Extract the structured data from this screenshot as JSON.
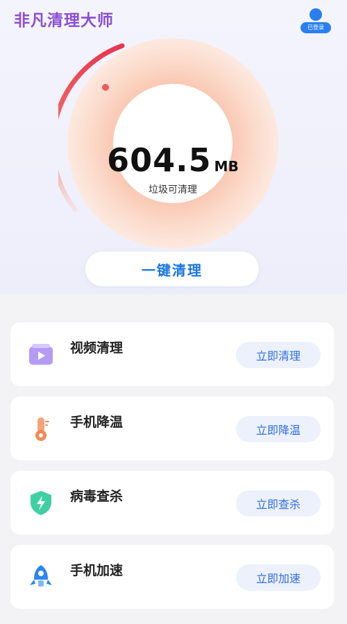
{
  "header": {
    "app_title": "非凡清理大师",
    "user_badge_label": "已登录"
  },
  "gauge": {
    "value": "604.5",
    "unit": "MB",
    "caption": "垃圾可清理",
    "accent_colors": [
      "#f04a5f",
      "#f7b49a",
      "#fde7dc"
    ]
  },
  "clean_button": {
    "label": "一键清理"
  },
  "features": [
    {
      "title": "视频清理",
      "action": "立即清理",
      "icon": "video-icon",
      "color": "#a98af0"
    },
    {
      "title": "手机降温",
      "action": "立即降温",
      "icon": "thermometer-icon",
      "color": "#f08a54"
    },
    {
      "title": "病毒查杀",
      "action": "立即查杀",
      "icon": "shield-icon",
      "color": "#34c99a"
    },
    {
      "title": "手机加速",
      "action": "立即加速",
      "icon": "rocket-icon",
      "color": "#2a86f0"
    }
  ]
}
